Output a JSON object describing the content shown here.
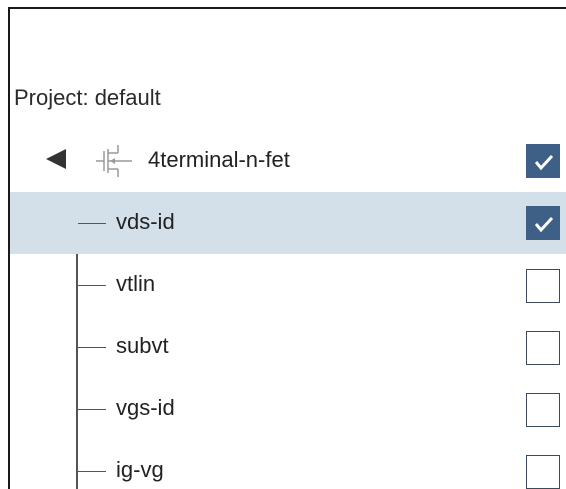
{
  "project": {
    "label": "Project: default"
  },
  "tree": {
    "root": {
      "label": "4terminal-n-fet",
      "expanded": true,
      "checked": true,
      "icon": "nfet-transistor-icon"
    },
    "children": [
      {
        "label": "vds-id",
        "checked": true,
        "selected": true
      },
      {
        "label": "vtlin",
        "checked": false,
        "selected": false
      },
      {
        "label": "subvt",
        "checked": false,
        "selected": false
      },
      {
        "label": "vgs-id",
        "checked": false,
        "selected": false
      },
      {
        "label": "ig-vg",
        "checked": false,
        "selected": false
      }
    ]
  },
  "colors": {
    "selected_row": "#d3dfe9",
    "checkbox_checked": "#3e5f86"
  }
}
